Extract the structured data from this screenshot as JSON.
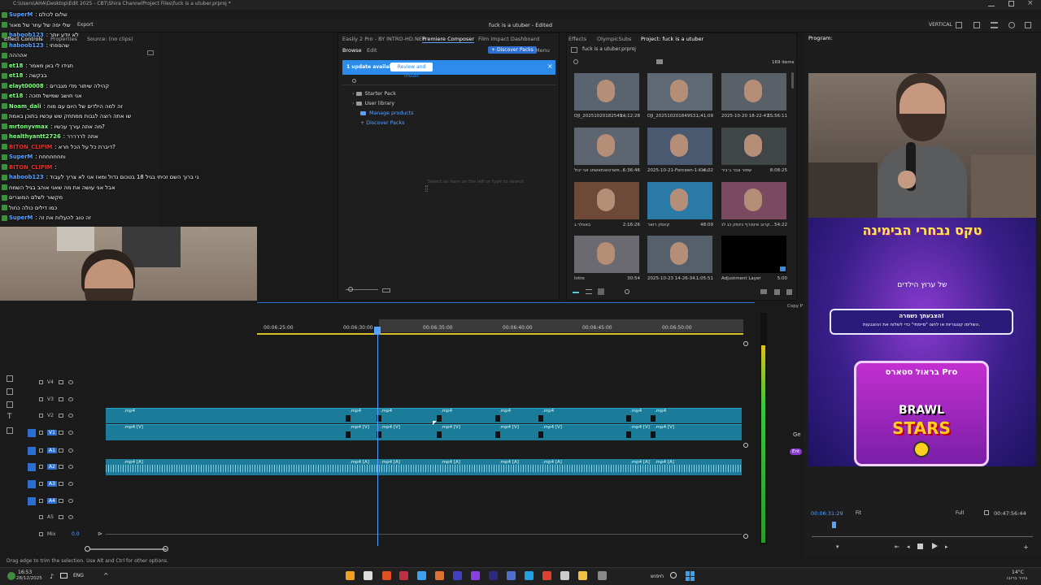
{
  "titlebar": {
    "path": "C:\\Users\\AHA\\Desktop\\Edit 2025 - CBT\\Shira ChannelProject Files\\fuck is a utuber.prproj *",
    "project_title": "fuck is a utuber - Edited",
    "workspace": "VERTICAL"
  },
  "menu": {
    "items": [
      "Import",
      "Edit",
      "Export"
    ]
  },
  "chat": {
    "lines": [
      {
        "user": "SuperM",
        "text": ": שלום לכולם",
        "color": "#5aa0ff"
      },
      {
        "user": "",
        "text": "שלי יפה של עוזר של מאור",
        "color": "#fff"
      },
      {
        "user": "haboob123",
        "text": ": לא יודע יותר",
        "color": "#5aa0ff"
      },
      {
        "user": "haboob123",
        "text": ": שהספתי",
        "color": "#5aa0ff"
      },
      {
        "user": "",
        "text": "אהההה",
        "color": "#fff"
      },
      {
        "user": "et18",
        "text": ": תגידו לי באן מאמר",
        "color": "#7fff7f"
      },
      {
        "user": "et18",
        "text": ": בבקשה",
        "color": "#7fff7f"
      },
      {
        "user": "elayt00008",
        "text": ": קהילה שיתור מדי מגברים",
        "color": "#7fff7f"
      },
      {
        "user": "et18",
        "text": ": אני חושב שמישל תזכה",
        "color": "#7fff7f"
      },
      {
        "user": "Noam_dali",
        "text": ": זה למה הילדים של היום עם מוח",
        "color": "#7fff7f"
      },
      {
        "user": "",
        "text": "שו אתה רוצה לגבות ממתחק שש עכשיו בתוכן באמת",
        "color": "#fff"
      },
      {
        "user": "mrtonyvmax",
        "text": ": מה אתה עורך עכשיו?",
        "color": "#7fff7f"
      },
      {
        "user": "healthyantt2726",
        "text": ": אתה לררררר",
        "color": "#7fff7f"
      },
      {
        "user": "BITON_CLIPIM",
        "text": ": דיברת כל על הכל חרא?",
        "color": "#e03030"
      },
      {
        "user": "SuperM",
        "text": ": וחחחחחחח",
        "color": "#5aa0ff"
      },
      {
        "user": "BITON_CLIPIM",
        "text": ":",
        "color": "#e03030"
      },
      {
        "user": "haboob123",
        "text": ": אני ברוך השם זכיתי בגיל 18 בטכום גדול ומאז אני לא צריך לעבוד",
        "color": "#5aa0ff"
      },
      {
        "user": "",
        "text": "אבל אני עושה את מה שאני אוהב בגיל השמח",
        "color": "#fff"
      },
      {
        "user": "",
        "text": "מקשור לשלם המוצרים",
        "color": "#fff"
      },
      {
        "user": "",
        "text": "כמו דילים כולה כחול",
        "color": "#fff"
      },
      {
        "user": "SuperM",
        "text": ": זה טוב להעלות את זה",
        "color": "#5aa0ff"
      }
    ]
  },
  "effect_controls": {
    "tabs": [
      "Effect Controls",
      "Properties",
      "Source: (no clips)"
    ]
  },
  "essential": {
    "tabs": [
      "Easily 2 Pro - BY INTRO-HD.NET",
      "Premiere Composer",
      "Film Impact Dashboard"
    ],
    "subtabs": [
      "Browse",
      "Edit"
    ],
    "discover_label": "Discover Packs",
    "menu_label": "Menu",
    "update_text": "1 update available",
    "review_label": "Review and install",
    "tree": [
      {
        "label": "Starter Pack",
        "blue": false
      },
      {
        "label": "User library",
        "blue": false
      },
      {
        "label": "Manage products",
        "blue": true
      },
      {
        "label": "Discover Packs",
        "blue": true
      }
    ],
    "empty_hint": "Select an item on the left or type to search"
  },
  "project": {
    "tabs": [
      "Effects",
      "OlympicSubs",
      "Project: fuck is a utuber"
    ],
    "file": "fuck is a utuber.prproj",
    "count": "169 items",
    "items": [
      {
        "name": "DJI_20251020182545...",
        "dur": "24;12;28",
        "color": "#5a6470"
      },
      {
        "name": "DJI_202510201849S3...",
        "dur": "1;41;09",
        "color": "#5f6875"
      },
      {
        "name": "2025-10-20 18-22-47...",
        "dur": "25:56:11",
        "color": "#5a6068"
      },
      {
        "name": "פשרטאותאשחג אני יכול...",
        "dur": "6:36:46",
        "color": "#5c6570"
      },
      {
        "name": "2025-10-21-Forceen-1-Klc...",
        "dur": "4:02",
        "color": "#4a5870"
      },
      {
        "name": "שחור צבר ג׳ביר",
        "dur": "8:08:25",
        "color": "#404548"
      },
      {
        "name": "באוולר.ג",
        "dur": "2:16:26",
        "color": "#6d4a38"
      },
      {
        "name": "קיוסק רואר",
        "dur": "48:09",
        "color": "#2a7aa8"
      },
      {
        "name": "קרוב אינטרף כיוסק כג לנ...",
        "dur": "54:22",
        "color": "#7a4a60"
      },
      {
        "name": "Intro",
        "dur": "30:54",
        "color": "#6a6a70"
      },
      {
        "name": "2025-10-23 14-26-34...",
        "dur": "1:05:51",
        "color": "#55606a"
      },
      {
        "name": "Adjustment Layer",
        "dur": "5:00",
        "color": "#000000"
      }
    ]
  },
  "program": {
    "title": "Program:",
    "timecode": "00:06:31:29",
    "fit": "Fit",
    "quality": "Full",
    "duration": "00:47:56:44",
    "banner_title": "טקס נבחרי הבימינה",
    "banner_sub": "של ערוץ הילדים",
    "banner_box_title": "הצבעתך נשמרה!",
    "banner_box_text": "השלימו קטגוריות או לחצו \"סיימתי\" כדי לשלוח את ההצבעות.",
    "card_title": "בראול סטארס Pro",
    "card_logo_line1": "BRAWL",
    "card_logo_line2": "STARS",
    "side_copy": "Copy P",
    "side_ge": "Ge",
    "side_ent": "Ent"
  },
  "timeline": {
    "ticks": [
      "00:06:25:00",
      "00:06:30:00",
      "00:06:35:00",
      "00:06:40:00",
      "00:06:45:00",
      "00:06:50:00"
    ],
    "tracks": [
      "V4",
      "V3",
      "V2",
      "V1",
      "A1",
      "A2",
      "A3",
      "A4",
      "A5",
      "Mix"
    ],
    "mix_value": "0.0",
    "video_clip_label": ".mp4",
    "video_clip_label_v": ".mp4 [V]",
    "audio_clip_label": ".mp4 [A]"
  },
  "status_bar": {
    "hint": "Drag edge to trim the selection. Use Alt and Ctrl for other options."
  },
  "taskbar": {
    "time": "16:53",
    "date": "28/12/2025",
    "lang": "ENG",
    "search": "חיפוש",
    "weather": "14°C",
    "weather_sub": "בהיר ברובו"
  }
}
